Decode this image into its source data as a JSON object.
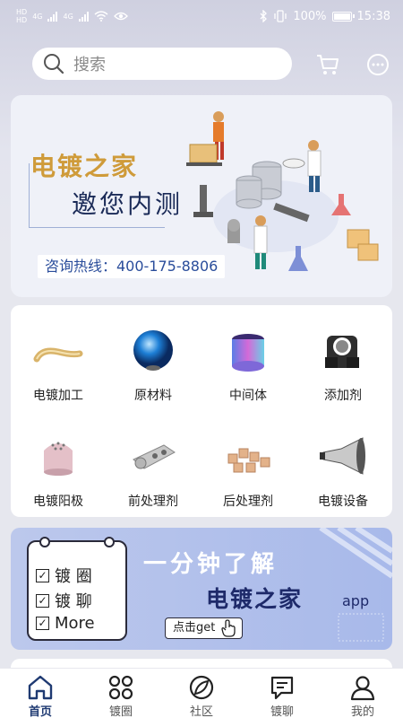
{
  "status_bar": {
    "hd1": "HD",
    "hd2": "HD",
    "net1": "4G",
    "net2": "4G",
    "battery_pct": "100%",
    "time": "15:38"
  },
  "search": {
    "placeholder": "搜索"
  },
  "banner": {
    "title": "电镀之家",
    "subtitle": "邀您内测",
    "hotline": "咨询热线：400-175-8806"
  },
  "categories": [
    {
      "label": "电镀加工",
      "icon": "handle-icon"
    },
    {
      "label": "原材料",
      "icon": "blue-disc-icon"
    },
    {
      "label": "中间体",
      "icon": "ring-icon"
    },
    {
      "label": "添加剂",
      "icon": "clamp-icon"
    },
    {
      "label": "电镀阳极",
      "icon": "anode-icon"
    },
    {
      "label": "前处理剂",
      "icon": "hinge-icon"
    },
    {
      "label": "后处理剂",
      "icon": "parts-icon"
    },
    {
      "label": "电镀设备",
      "icon": "horn-icon"
    }
  ],
  "promo": {
    "items": [
      "镀 圈",
      "镀 聊",
      "More"
    ],
    "headline": "一分钟了解",
    "brand": "电镀之家",
    "brand_suffix": "app",
    "cta": "点击get"
  },
  "nav": {
    "items": [
      {
        "label": "首页",
        "icon": "home-icon",
        "active": true
      },
      {
        "label": "镀圈",
        "icon": "grid-icon",
        "active": false
      },
      {
        "label": "社区",
        "icon": "leaf-icon",
        "active": false
      },
      {
        "label": "镀聊",
        "icon": "chat-icon",
        "active": false
      },
      {
        "label": "我的",
        "icon": "user-icon",
        "active": false
      }
    ]
  },
  "colors": {
    "accent": "#1f3a72",
    "banner_gold": "#cf9b3a",
    "hotline_blue": "#2a4d9b",
    "promo_bg": "#a8b9ea"
  }
}
